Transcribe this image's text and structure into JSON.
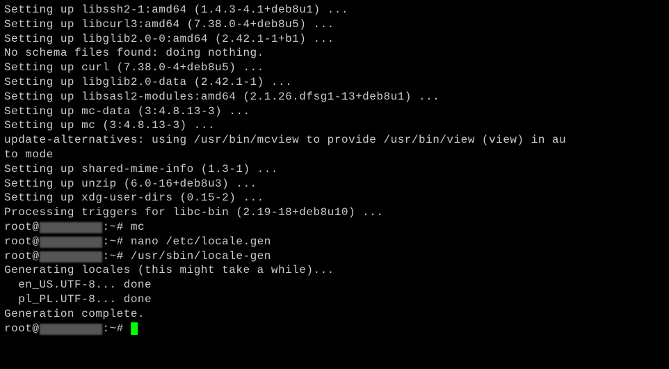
{
  "lines": [
    "Setting up libssh2-1:amd64 (1.4.3-4.1+deb8u1) ...",
    "Setting up libcurl3:amd64 (7.38.0-4+deb8u5) ...",
    "Setting up libglib2.0-0:amd64 (2.42.1-1+b1) ...",
    "No schema files found: doing nothing.",
    "Setting up curl (7.38.0-4+deb8u5) ...",
    "Setting up libglib2.0-data (2.42.1-1) ...",
    "Setting up libsasl2-modules:amd64 (2.1.26.dfsg1-13+deb8u1) ...",
    "Setting up mc-data (3:4.8.13-3) ...",
    "Setting up mc (3:4.8.13-3) ...",
    "update-alternatives: using /usr/bin/mcview to provide /usr/bin/view (view) in au",
    "to mode",
    "Setting up shared-mime-info (1.3-1) ...",
    "Setting up unzip (6.0-16+deb8u3) ...",
    "Setting up xdg-user-dirs (0.15-2) ...",
    "Processing triggers for libc-bin (2.19-18+deb8u10) ..."
  ],
  "prompt1": {
    "user": "root@",
    "redacted": "XXXXXXXXX",
    "suffix": ":~# ",
    "command": "mc"
  },
  "blank": "",
  "prompt2": {
    "user": "root@",
    "redacted": "XXXXXXXXX",
    "suffix": ":~# ",
    "command": "nano /etc/locale.gen"
  },
  "prompt3": {
    "user": "root@",
    "redacted": "XXXXXXXXX",
    "suffix": ":~# ",
    "command": "/usr/sbin/locale-gen"
  },
  "gen_lines": [
    "Generating locales (this might take a while)...",
    "  en_US.UTF-8... done",
    "  pl_PL.UTF-8... done",
    "Generation complete."
  ],
  "prompt4": {
    "user": "root@",
    "redacted": "XXXXXXXXX",
    "suffix": ":~# "
  }
}
